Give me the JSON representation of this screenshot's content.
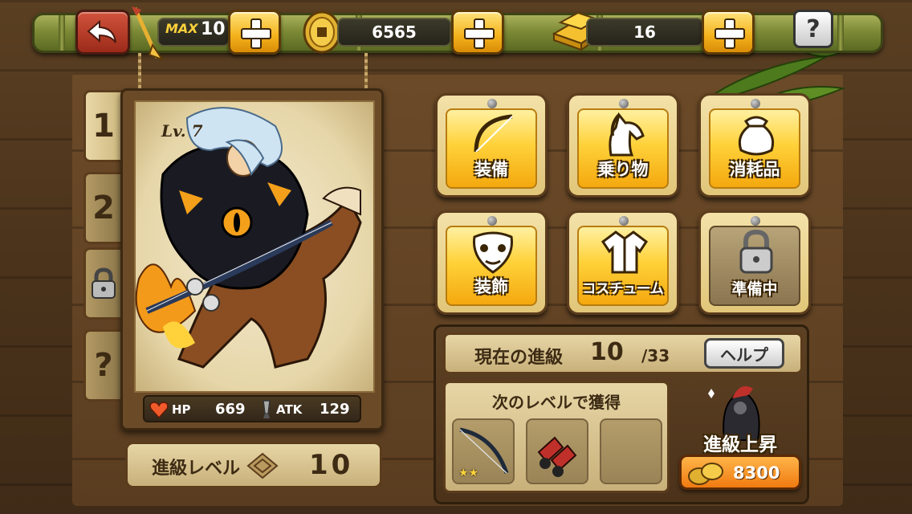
{
  "topbar": {
    "stamina_label": "MAX",
    "stamina_value": "10",
    "coins": "6565",
    "gold": "16",
    "help": "?"
  },
  "tabs": [
    {
      "label": "1"
    },
    {
      "label": "2"
    },
    {
      "label": ""
    },
    {
      "label": "?"
    }
  ],
  "hero": {
    "level": "Lv. 7",
    "hp_label": "HP",
    "hp_value": "669",
    "atk_label": "ATK",
    "atk_value": "129"
  },
  "grade": {
    "label": "進級レベル",
    "value": "10"
  },
  "menu": [
    {
      "label": "装備",
      "icon": "bow-icon"
    },
    {
      "label": "乗り物",
      "icon": "horse-icon"
    },
    {
      "label": "消耗品",
      "icon": "pouch-icon"
    },
    {
      "label": "装飾",
      "icon": "mask-icon"
    },
    {
      "label": "コスチューム",
      "icon": "costume-icon"
    },
    {
      "label": "準備中",
      "icon": "lock-icon"
    }
  ],
  "promotion": {
    "title": "現在の進級",
    "current": "10",
    "max": "/33",
    "help": "ヘルプ",
    "next_title": "次のレベルで獲得",
    "reward_stars": "★★",
    "upgrade_label": "進級上昇",
    "cost": "8300"
  },
  "colors": {
    "gold_button": "#f4b11b",
    "back_button": "#c0412c",
    "cost_button": "#f07a10"
  }
}
